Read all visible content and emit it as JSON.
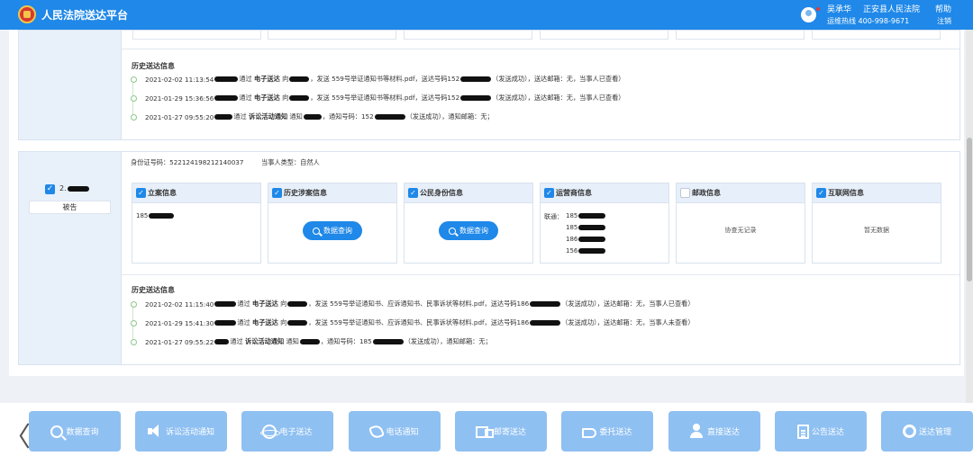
{
  "header": {
    "title": "人民法院送达平台",
    "user_name": "吴承华",
    "court_name": "正安县人民法院",
    "help_label": "帮助",
    "hotline": "运维热线 400-998-9671",
    "logout_label": "注销"
  },
  "section1": {
    "history_title": "历史送达信息",
    "history": [
      {
        "time": "2021-02-02 11:13:54",
        "via": "通过",
        "method": "电子送达",
        "to": "向",
        "send": "，发送 559号举证通知书等材料.pdf，送达号码152",
        "status": "（发送成功），送达邮箱：无，当事人已查看）"
      },
      {
        "time": "2021-01-29 15:36:56",
        "via": "通过",
        "method": "电子送达",
        "to": "向",
        "send": "，发送 559号举证通知书等材料.pdf，送达号码152",
        "status": "（发送成功），送达邮箱：无，当事人已查看）"
      },
      {
        "time": "2021-01-27 09:55:20",
        "via": "通过",
        "method": "诉讼活动通知",
        "to": "通知",
        "send": "，通知号码：152",
        "status": "（发送成功），通知邮箱：无；"
      }
    ]
  },
  "section2": {
    "party_number": "2.",
    "party_role": "被告",
    "id_number_label": "身份证号码：522124198212140037",
    "party_type_label": "当事人类型：自然人",
    "cards": [
      {
        "title": "立案信息",
        "checked": true,
        "phone": "185"
      },
      {
        "title": "历史涉案信息",
        "checked": true,
        "button": "数据查询"
      },
      {
        "title": "公民身份信息",
        "checked": true,
        "button": "数据查询"
      },
      {
        "title": "运营商信息",
        "checked": true,
        "carrier": "联通：",
        "phones": [
          "185",
          "185",
          "186",
          "156"
        ]
      },
      {
        "title": "邮政信息",
        "checked": false,
        "note": "协查无记录"
      },
      {
        "title": "互联网信息",
        "checked": true,
        "note": "暂无数据"
      }
    ],
    "history_title": "历史送达信息",
    "history": [
      {
        "time": "2021-02-02 11:15:40",
        "via": "通过",
        "method": "电子送达",
        "to": "向",
        "send": "，发送 559号举证通知书、应诉通知书、民事诉状等材料.pdf，送达号码186",
        "status": "（发送成功），送达邮箱：无，当事人已查看）"
      },
      {
        "time": "2021-01-29 15:41:30",
        "via": "通过",
        "method": "电子送达",
        "to": "向",
        "send": "，发送 559号举证通知书、应诉通知书、民事诉状等材料.pdf，送达号码186",
        "status": "（发送成功），送达邮箱：无，当事人未查看）"
      },
      {
        "time": "2021-01-27 09:55:22",
        "via": "通过",
        "method": "诉讼活动通知",
        "to": "通知",
        "send": "，通知号码：185",
        "status": "（发送成功），通知邮箱：无；"
      }
    ]
  },
  "toolbar": {
    "prev_arrow": "〈",
    "buttons": [
      {
        "label": "数据查询",
        "icon": "search-icon"
      },
      {
        "label": "诉讼活动通知",
        "icon": "speaker-icon"
      },
      {
        "label": "电子送达",
        "icon": "globe-icon"
      },
      {
        "label": "电话通知",
        "icon": "phone-icon"
      },
      {
        "label": "邮寄送达",
        "icon": "truck-icon"
      },
      {
        "label": "委托送达",
        "icon": "handshake-icon"
      },
      {
        "label": "直接送达",
        "icon": "person-icon"
      },
      {
        "label": "公告送达",
        "icon": "document-icon"
      },
      {
        "label": "送达管理",
        "icon": "gear-icon"
      }
    ]
  },
  "colors": {
    "header_bg": "#1f88e8",
    "toolbar_button_bg": "#8fc0f2",
    "card_header_bg": "#e6effa",
    "redaction": "#111111"
  }
}
